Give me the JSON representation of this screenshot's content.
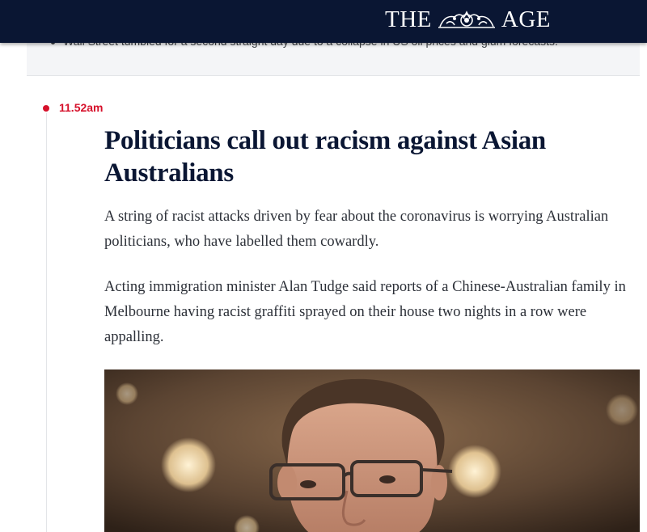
{
  "header": {
    "masthead_left": "THE",
    "masthead_right": "AGE",
    "crest_icon": "coat-of-arms-icon",
    "background": "#0a1633"
  },
  "previous_post": {
    "bullet_text": "Wall Street tumbled for a second straight day due to a collapse in US oil prices and glum forecasts."
  },
  "post": {
    "timestamp": "11.52am",
    "headline": "Politicians call out racism against Asian Australians",
    "paragraphs": [
      "A string of racist attacks driven by fear about the coronavirus is worrying Australian politicians, who have labelled them cowardly.",
      "Acting immigration minister Alan Tudge said reports of a Chinese-Australian family in Melbourne having racist graffiti sprayed on their house two nights in a row were appalling."
    ],
    "accent_color": "#d6112b"
  }
}
